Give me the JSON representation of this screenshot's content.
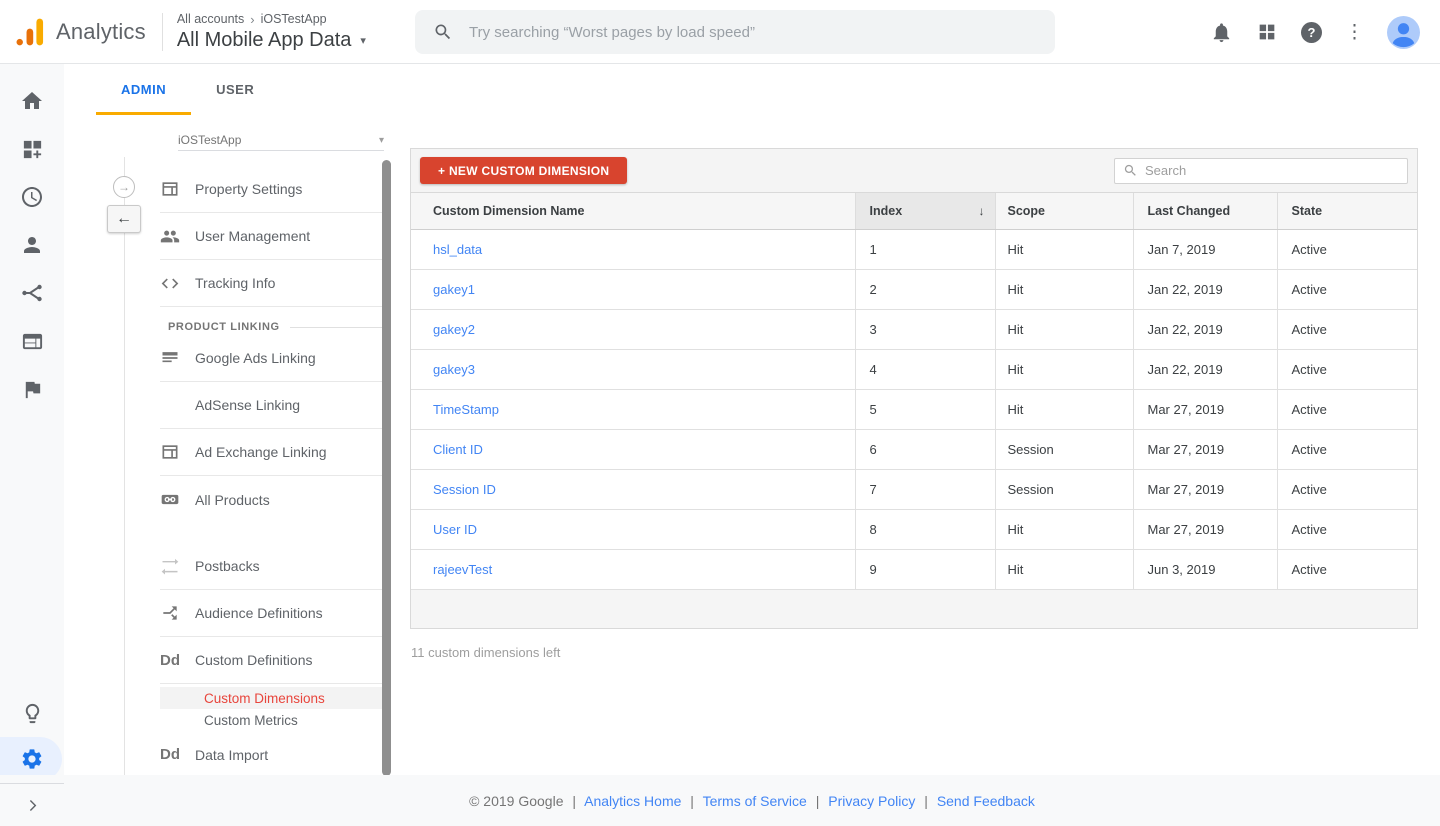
{
  "header": {
    "logo_text": "Analytics",
    "breadcrumb": [
      "All accounts",
      "iOSTestApp"
    ],
    "property_title": "All Mobile App Data",
    "search_placeholder": "Try searching “Worst pages by load speed”"
  },
  "tabs": {
    "admin": "ADMIN",
    "user": "USER"
  },
  "sidebar": {
    "property_selector": "iOSTestApp",
    "items": {
      "property_settings": "Property Settings",
      "user_management": "User Management",
      "tracking_info": "Tracking Info",
      "product_linking": "PRODUCT LINKING",
      "google_ads_linking": "Google Ads Linking",
      "adsense_linking": "AdSense Linking",
      "ad_exchange_linking": "Ad Exchange Linking",
      "all_products": "All Products",
      "postbacks": "Postbacks",
      "audience_definitions": "Audience Definitions",
      "custom_definitions": "Custom Definitions",
      "custom_dimensions": "Custom Dimensions",
      "custom_metrics": "Custom Metrics",
      "data_import": "Data Import"
    }
  },
  "main": {
    "new_button": "+ NEW CUSTOM DIMENSION",
    "search_placeholder": "Search",
    "table": {
      "columns": [
        "Custom Dimension Name",
        "Index",
        "Scope",
        "Last Changed",
        "State"
      ],
      "rows": [
        {
          "name": "hsl_data",
          "index": "1",
          "scope": "Hit",
          "last_changed": "Jan 7, 2019",
          "state": "Active"
        },
        {
          "name": "gakey1",
          "index": "2",
          "scope": "Hit",
          "last_changed": "Jan 22, 2019",
          "state": "Active"
        },
        {
          "name": "gakey2",
          "index": "3",
          "scope": "Hit",
          "last_changed": "Jan 22, 2019",
          "state": "Active"
        },
        {
          "name": "gakey3",
          "index": "4",
          "scope": "Hit",
          "last_changed": "Jan 22, 2019",
          "state": "Active"
        },
        {
          "name": "TimeStamp",
          "index": "5",
          "scope": "Hit",
          "last_changed": "Mar 27, 2019",
          "state": "Active"
        },
        {
          "name": "Client ID",
          "index": "6",
          "scope": "Session",
          "last_changed": "Mar 27, 2019",
          "state": "Active"
        },
        {
          "name": "Session ID",
          "index": "7",
          "scope": "Session",
          "last_changed": "Mar 27, 2019",
          "state": "Active"
        },
        {
          "name": "User ID",
          "index": "8",
          "scope": "Hit",
          "last_changed": "Mar 27, 2019",
          "state": "Active"
        },
        {
          "name": "rajeevTest",
          "index": "9",
          "scope": "Hit",
          "last_changed": "Jun 3, 2019",
          "state": "Active"
        }
      ]
    },
    "remaining_note": "11 custom dimensions left"
  },
  "footer": {
    "copyright": "© 2019 Google",
    "separator": "|",
    "links": [
      "Analytics Home",
      "Terms of Service",
      "Privacy Policy",
      "Send Feedback"
    ]
  },
  "icons": {
    "caret_down": "▾",
    "chevron_right": "›",
    "sort_desc": "↓",
    "nav_forward": "→",
    "nav_back": "←",
    "more_vert": "⋮",
    "help": "?",
    "dd": "Dd"
  },
  "colors": {
    "accent_blue": "#1a73e8",
    "link_blue": "#4285f4",
    "tab_underline_orange": "#f9ab00",
    "logo_orange": "#f9ab00",
    "logo_orange_dark": "#e8710a",
    "button_red": "#d8442e",
    "active_item_red": "#e8453c"
  }
}
